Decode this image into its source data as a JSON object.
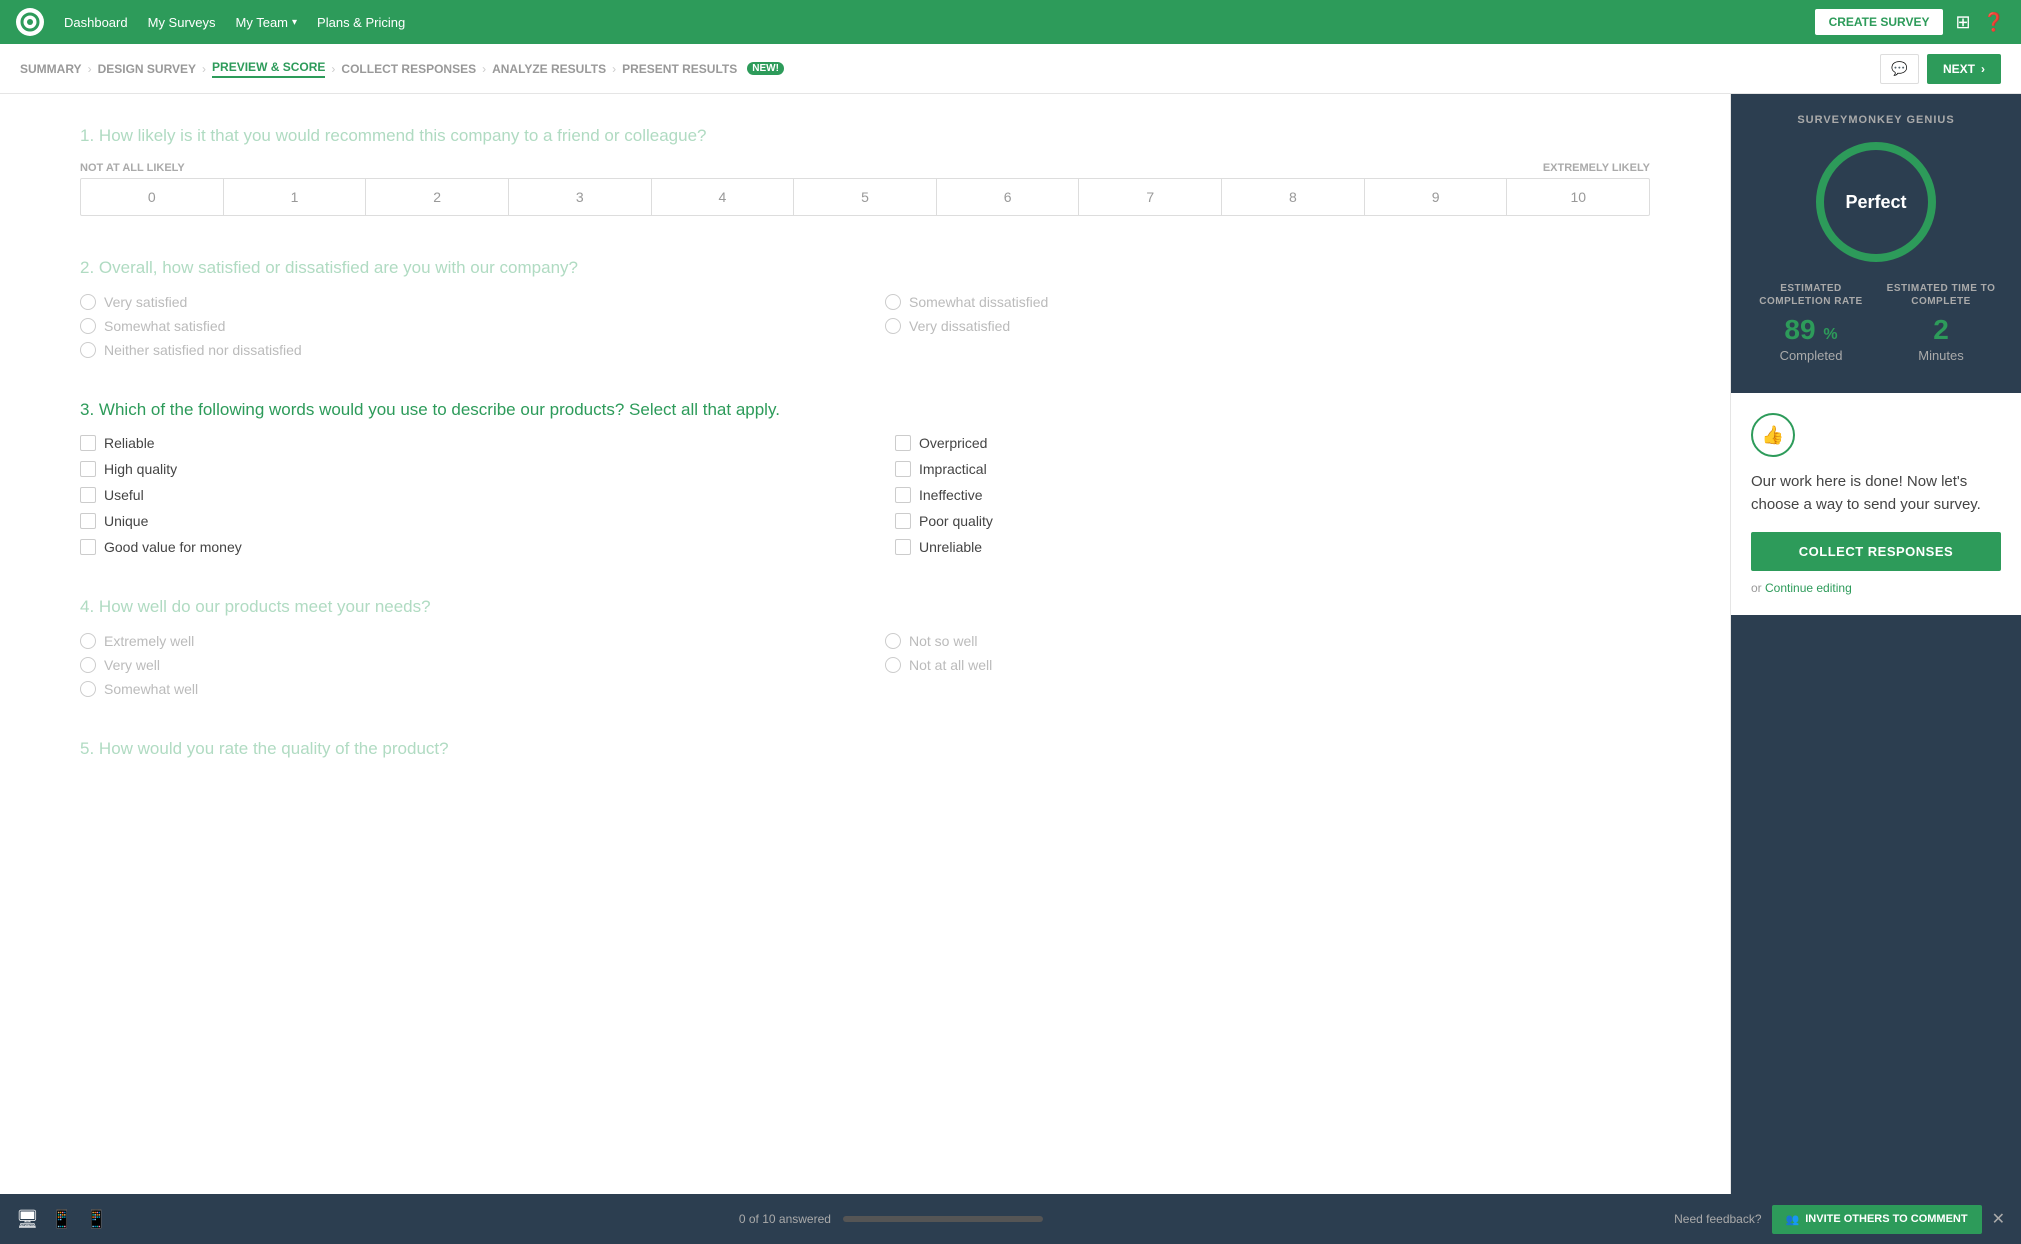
{
  "nav": {
    "logo_alt": "SurveyMonkey logo",
    "items": [
      {
        "label": "Dashboard",
        "has_dropdown": false
      },
      {
        "label": "My Surveys",
        "has_dropdown": false
      },
      {
        "label": "My Team",
        "has_dropdown": true
      },
      {
        "label": "Plans & Pricing",
        "has_dropdown": false
      }
    ],
    "create_survey_label": "CREATE SURVEY",
    "grid_icon": "⊞",
    "help_icon": "?"
  },
  "step_nav": {
    "steps": [
      {
        "label": "SUMMARY",
        "active": false
      },
      {
        "label": "DESIGN SURVEY",
        "active": false
      },
      {
        "label": "PREVIEW & SCORE",
        "active": true
      },
      {
        "label": "COLLECT RESPONSES",
        "active": false
      },
      {
        "label": "ANALYZE RESULTS",
        "active": false
      },
      {
        "label": "PRESENT RESULTS",
        "active": false,
        "badge": "NEW!"
      }
    ],
    "next_label": "NEXT",
    "comment_icon": "💬"
  },
  "questions": [
    {
      "id": "q1",
      "number": "1.",
      "text": "How likely is it that you would recommend this company to a friend or colleague?",
      "type": "nps",
      "active": false,
      "nps_labels": {
        "left": "NOT AT ALL LIKELY",
        "right": "EXTREMELY LIKELY"
      },
      "nps_values": [
        "0",
        "1",
        "2",
        "3",
        "4",
        "5",
        "6",
        "7",
        "8",
        "9",
        "10"
      ]
    },
    {
      "id": "q2",
      "number": "2.",
      "text": "Overall, how satisfied or dissatisfied are you with our company?",
      "type": "radio",
      "active": false,
      "options_col1": [
        "Very satisfied",
        "Somewhat satisfied",
        "Neither satisfied nor dissatisfied"
      ],
      "options_col2": [
        "Somewhat dissatisfied",
        "Very dissatisfied"
      ]
    },
    {
      "id": "q3",
      "number": "3.",
      "text": "Which of the following words would you use to describe our products? Select all that apply.",
      "type": "checkbox",
      "active": true,
      "options_col1": [
        "Reliable",
        "High quality",
        "Useful",
        "Unique",
        "Good value for money"
      ],
      "options_col2": [
        "Overpriced",
        "Impractical",
        "Ineffective",
        "Poor quality",
        "Unreliable"
      ]
    },
    {
      "id": "q4",
      "number": "4.",
      "text": "How well do our products meet your needs?",
      "type": "radio",
      "active": false,
      "options_col1": [
        "Extremely well",
        "Very well",
        "Somewhat well"
      ],
      "options_col2": [
        "Not so well",
        "Not at all well"
      ]
    },
    {
      "id": "q5",
      "number": "5.",
      "text": "How would you rate the quality of the product?",
      "type": "radio",
      "active": false,
      "options_col1": [],
      "options_col2": []
    }
  ],
  "sidebar": {
    "genius_title": "SURVEYMONKEY GENIUS",
    "gauge_text": "Perfect",
    "stats": {
      "completion_label": "ESTIMATED COMPLETION RATE",
      "completion_value": "89",
      "completion_unit": "Completed",
      "time_label": "ESTIMATED TIME TO COMPLETE",
      "time_value": "2",
      "time_unit": "Minutes"
    },
    "panel_text": "Our work here is done! Now let's choose a way to send your survey.",
    "collect_btn": "COLLECT RESPONSES",
    "or_text": "or",
    "continue_link": "Continue editing"
  },
  "bottom": {
    "progress_text": "0 of 10 answered",
    "progress_pct": 0,
    "feedback_label": "Need feedback?",
    "invite_label": "INVITE OTHERS TO COMMENT"
  }
}
